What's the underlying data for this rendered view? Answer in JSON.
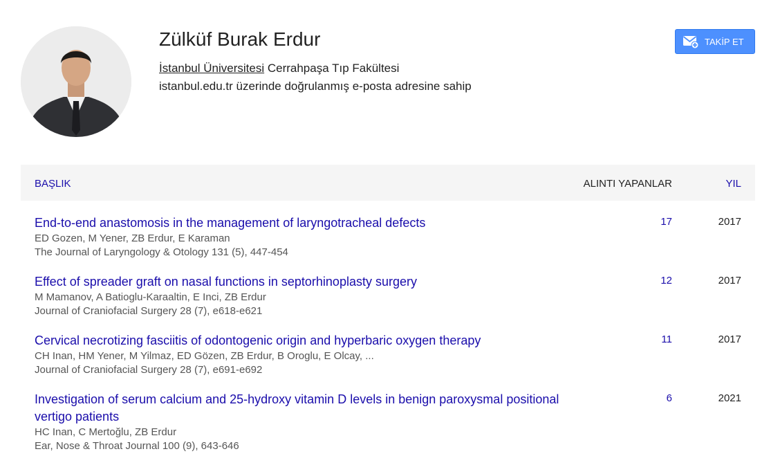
{
  "profile": {
    "name": "Zülküf Burak Erdur",
    "org_link": "İstanbul Üniversitesi",
    "org_rest": " Cerrahpaşa Tıp Fakültesi",
    "email_note": "istanbul.edu.tr üzerinde doğrulanmış e-posta adresine sahip"
  },
  "follow_button": {
    "label": "TAKİP ET"
  },
  "table": {
    "col_title": "BAŞLIK",
    "col_cited": "ALINTI YAPANLAR",
    "col_year": "YIL",
    "rows": [
      {
        "title": "End-to-end anastomosis in the management of laryngotracheal defects",
        "authors": "ED Gozen, M Yener, ZB Erdur, E Karaman",
        "venue": "The Journal of Laryngology & Otology 131 (5), 447-454",
        "cites": "17",
        "year": "2017"
      },
      {
        "title": "Effect of spreader graft on nasal functions in septorhinoplasty surgery",
        "authors": "M Mamanov, A Batioglu-Karaaltin, E Inci, ZB Erdur",
        "venue": "Journal of Craniofacial Surgery 28 (7), e618-e621",
        "cites": "12",
        "year": "2017"
      },
      {
        "title": "Cervical necrotizing fasciitis of odontogenic origin and hyperbaric oxygen therapy",
        "authors": "CH Inan, HM Yener, M Yilmaz, ED Gözen, ZB Erdur, B Oroglu, E Olcay, ...",
        "venue": "Journal of Craniofacial Surgery 28 (7), e691-e692",
        "cites": "11",
        "year": "2017"
      },
      {
        "title": "Investigation of serum calcium and 25-hydroxy vitamin D levels in benign paroxysmal positional vertigo patients",
        "authors": "HC Inan, C Mertoğlu, ZB Erdur",
        "venue": "Ear, Nose & Throat Journal 100 (9), 643-646",
        "cites": "6",
        "year": "2021"
      }
    ]
  }
}
